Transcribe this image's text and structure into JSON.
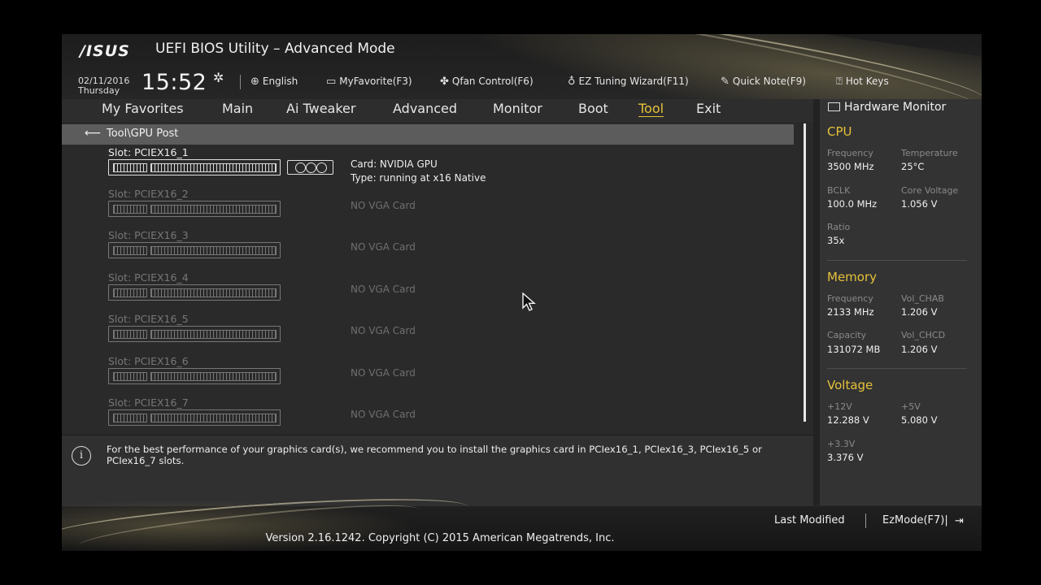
{
  "header": {
    "logo": "/ISUS",
    "title": "UEFI BIOS Utility – Advanced Mode",
    "date": "02/11/2016",
    "day": "Thursday",
    "time": "15:52",
    "toolbar": [
      {
        "icon": "globe-icon",
        "label": "English"
      },
      {
        "icon": "keyboard-icon",
        "label": "MyFavorite(F3)"
      },
      {
        "icon": "fan-icon",
        "label": "Qfan Control(F6)"
      },
      {
        "icon": "lightbulb-icon",
        "label": "EZ Tuning Wizard(F11)"
      },
      {
        "icon": "note-icon",
        "label": "Quick Note(F9)"
      },
      {
        "icon": "help-icon",
        "label": "Hot Keys"
      }
    ]
  },
  "nav": {
    "tabs": [
      {
        "label": "My Favorites"
      },
      {
        "label": "Main"
      },
      {
        "label": "Ai Tweaker"
      },
      {
        "label": "Advanced"
      },
      {
        "label": "Monitor"
      },
      {
        "label": "Boot"
      },
      {
        "label": "Tool",
        "active": true
      },
      {
        "label": "Exit"
      }
    ]
  },
  "breadcrumb": "Tool\\GPU Post",
  "slots": [
    {
      "label": "Slot: PCIEX16_1",
      "card": "Card: NVIDIA GPU",
      "type": "Type: running at x16 Native",
      "present": true
    },
    {
      "label": "Slot: PCIEX16_2",
      "card": "NO VGA Card",
      "present": false
    },
    {
      "label": "Slot: PCIEX16_3",
      "card": "NO VGA Card",
      "present": false
    },
    {
      "label": "Slot: PCIEX16_4",
      "card": "NO VGA Card",
      "present": false
    },
    {
      "label": "Slot: PCIEX16_5",
      "card": "NO VGA Card",
      "present": false
    },
    {
      "label": "Slot: PCIEX16_6",
      "card": "NO VGA Card",
      "present": false
    },
    {
      "label": "Slot: PCIEX16_7",
      "card": "NO VGA Card",
      "present": false
    }
  ],
  "info": {
    "text": "For the best performance of your graphics card(s), we recommend you to install the graphics card in PCIex16_1, PCIex16_3, PCIex16_5 or PCIex16_7 slots."
  },
  "hardware_monitor": {
    "title": "Hardware Monitor",
    "cpu": {
      "heading": "CPU",
      "frequency_label": "Frequency",
      "frequency": "3500 MHz",
      "temperature_label": "Temperature",
      "temperature": "25°C",
      "bclk_label": "BCLK",
      "bclk": "100.0 MHz",
      "core_voltage_label": "Core Voltage",
      "core_voltage": "1.056 V",
      "ratio_label": "Ratio",
      "ratio": "35x"
    },
    "memory": {
      "heading": "Memory",
      "frequency_label": "Frequency",
      "frequency": "2133 MHz",
      "vol_chab_label": "Vol_CHAB",
      "vol_chab": "1.206 V",
      "capacity_label": "Capacity",
      "capacity": "131072 MB",
      "vol_chcd_label": "Vol_CHCD",
      "vol_chcd": "1.206 V"
    },
    "voltage": {
      "heading": "Voltage",
      "v12_label": "+12V",
      "v12": "12.288 V",
      "v5_label": "+5V",
      "v5": "5.080 V",
      "v33_label": "+3.3V",
      "v33": "3.376 V"
    }
  },
  "footer": {
    "last_modified": "Last Modified",
    "ezmode": "EzMode(F7)|",
    "version": "Version 2.16.1242. Copyright (C) 2015 American Megatrends, Inc."
  }
}
